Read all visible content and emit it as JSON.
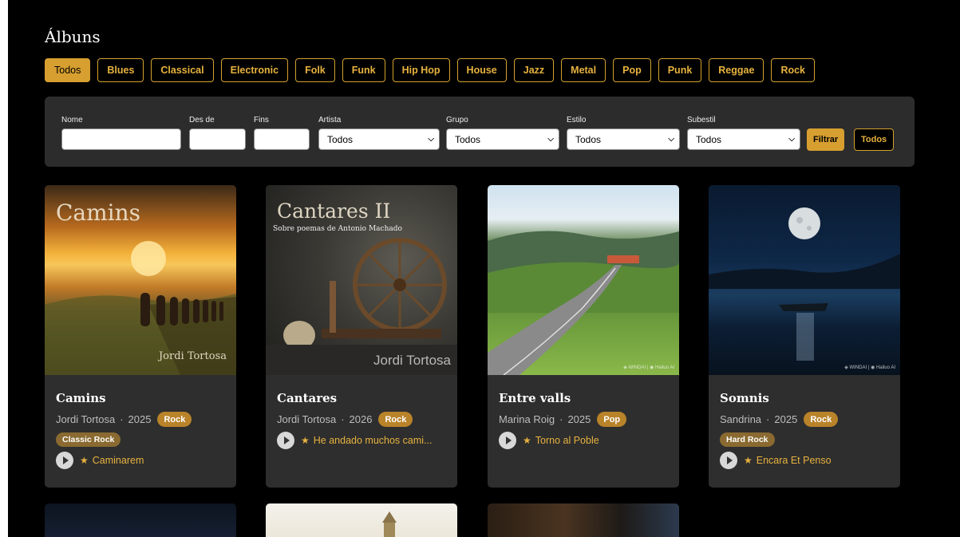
{
  "page_title": "Álbuns",
  "genres": [
    "Todos",
    "Blues",
    "Classical",
    "Electronic",
    "Folk",
    "Funk",
    "Hip Hop",
    "House",
    "Jazz",
    "Metal",
    "Pop",
    "Punk",
    "Reggae",
    "Rock"
  ],
  "active_genre": "Todos",
  "filters": {
    "nome_label": "Nome",
    "desde_label": "Des de",
    "fins_label": "Fins",
    "artista_label": "Artista",
    "artista_value": "Todos",
    "grupo_label": "Grupo",
    "grupo_value": "Todos",
    "estilo_label": "Estilo",
    "estilo_value": "Todos",
    "subestil_label": "Subestil",
    "subestil_value": "Todos",
    "filtrar_button": "Filtrar",
    "todos_button": "Todos"
  },
  "albums": [
    {
      "cover_title": "Camins",
      "cover_artist": "Jordi Tortosa",
      "title": "Camins",
      "artist": "Jordi Tortosa",
      "year": "2025",
      "genre": "Rock",
      "subgenre": "Classic Rock",
      "track": "Caminarem"
    },
    {
      "cover_title": "Cantares II",
      "cover_subtitle": "Sobre poemas de Antonio Machado",
      "cover_artist": "Jordi Tortosa",
      "title": "Cantares",
      "artist": "Jordi Tortosa",
      "year": "2026",
      "genre": "Rock",
      "track": "He andado muchos cami..."
    },
    {
      "cover_watermark": "◈ WINDAI | ◉ Hailuo AI",
      "title": "Entre valls",
      "artist": "Marina Roig",
      "year": "2025",
      "genre": "Pop",
      "track": "Torno al Poble"
    },
    {
      "cover_watermark": "◈ WINDAI | ◉ Hailuo AI",
      "title": "Somnis",
      "artist": "Sandrina",
      "year": "2025",
      "genre": "Rock",
      "subgenre": "Hard Rock",
      "track": "Encara Et Penso"
    }
  ],
  "colors": {
    "accent": "#d79f30",
    "card_bg": "#2e2e2e",
    "panel_bg": "#2c2c2c",
    "badge": "#b9832a",
    "subbadge": "#8a6a30"
  }
}
